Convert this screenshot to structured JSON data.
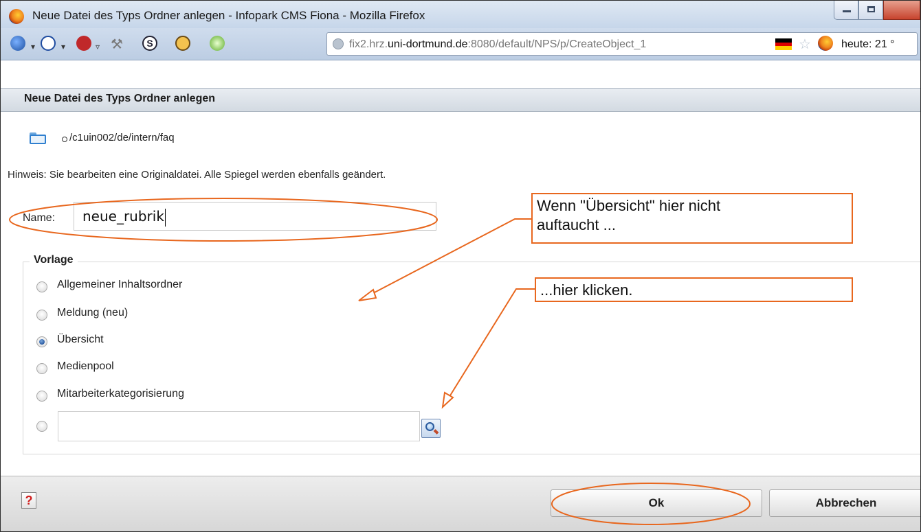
{
  "window": {
    "title": "Neue Datei des Typs Ordner anlegen - Infopark CMS Fiona - Mozilla Firefox"
  },
  "toolbar": {
    "url_host_prefix": "fix2.hrz.",
    "url_host_main": "uni-dortmund.de",
    "url_rest": ":8080/default/NPS/p/CreateObject_1",
    "heute": "heute: 21 °"
  },
  "dialog": {
    "header": "Neue Datei des Typs Ordner anlegen",
    "path": "/c1uin002/de/intern/faq",
    "hint": "Hinweis: Sie bearbeiten eine Originaldatei. Alle Spiegel werden ebenfalls geändert.",
    "name_label": "Name:",
    "name_value": "neue_rubrik",
    "vorlage_legend": "Vorlage",
    "vorlage_options": [
      {
        "label": "Allgemeiner Inhaltsordner",
        "checked": false
      },
      {
        "label": "Meldung (neu)",
        "checked": false
      },
      {
        "label": "Übersicht",
        "checked": true
      },
      {
        "label": "Medienpool",
        "checked": false
      },
      {
        "label": "Mitarbeiterkategorisierung",
        "checked": false
      }
    ],
    "custom_value": ""
  },
  "footer": {
    "help": "?",
    "ok": "Ok",
    "cancel": "Abbrechen"
  },
  "annotations": {
    "callout1_line1": "Wenn \"Übersicht\" hier nicht",
    "callout1_line2": "auftaucht ...",
    "callout2": "...hier klicken.",
    "color": "#e8671e"
  }
}
